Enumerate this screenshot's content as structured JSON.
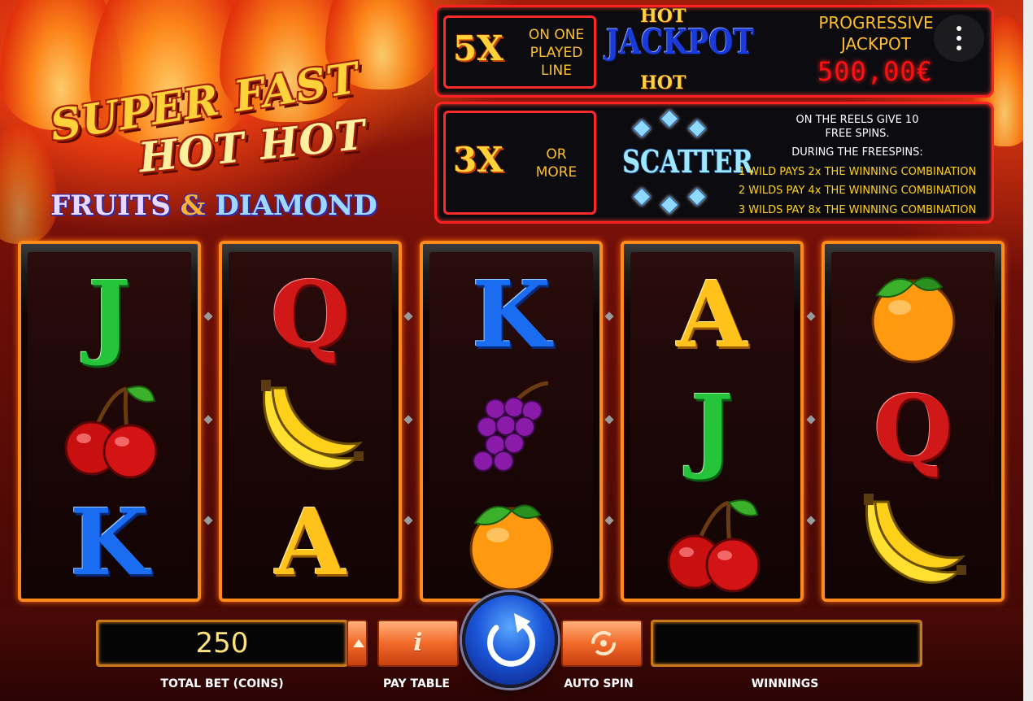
{
  "logo": {
    "line1": "SUPER FAST",
    "line2": "HOT HOT",
    "line3_a": "FRUITS",
    "line3_amp": "&",
    "line3_b": "DIAMOND"
  },
  "jackpot_panel": {
    "multiplier": "5X",
    "multiplier_text": [
      "ON ONE",
      "PLAYED",
      "LINE"
    ],
    "hot_top": "HOT",
    "jackpot_word": "JACKPOT",
    "hot_bottom": "HOT",
    "progressive_label": [
      "PROGRESSIVE",
      "JACKPOT"
    ],
    "progressive_value": "500,00€"
  },
  "scatter_panel": {
    "multiplier": "3X",
    "multiplier_text": [
      "OR",
      "MORE"
    ],
    "scatter_word": "SCATTER",
    "rules": [
      {
        "text": "ON THE REELS GIVE 10",
        "color": "white"
      },
      {
        "text": "FREE SPINS.",
        "color": "white"
      },
      {
        "text": "DURING THE FREESPINS:",
        "color": "white"
      },
      {
        "text": "1 WILD PAYS 2x THE WINNING COMBINATION",
        "color": "yellow"
      },
      {
        "text": "2 WILDS PAY 4x THE WINNING COMBINATION",
        "color": "yellow"
      },
      {
        "text": "3 WILDS PAY 8x THE WINNING COMBINATION",
        "color": "yellow"
      }
    ]
  },
  "reels": [
    [
      "J",
      "cherry",
      "K"
    ],
    [
      "Q",
      "banana",
      "A"
    ],
    [
      "K",
      "grapes",
      "orange"
    ],
    [
      "A",
      "J",
      "cherry"
    ],
    [
      "orange",
      "Q",
      "banana"
    ]
  ],
  "controls": {
    "total_bet_value": "250",
    "total_bet_label": "TOTAL BET (COINS)",
    "bet_up_icon": "triangle-up-icon",
    "pay_table_glyph": "i",
    "pay_table_label": "PAY TABLE",
    "spin_icon": "circular-arrow-icon",
    "auto_spin_icon": "auto-spin-icon",
    "auto_spin_label": "AUTO SPIN",
    "winnings_value": "",
    "winnings_label": "WINNINGS"
  },
  "menu_icon": "vertical-dots-icon",
  "colors": {
    "panel_border": "#ff2222",
    "reel_border": "#ff8a1a",
    "jackpot_value": "#ff1010",
    "accent_orange": "#ffbf2a",
    "spin_blue": "#1b56d8"
  }
}
